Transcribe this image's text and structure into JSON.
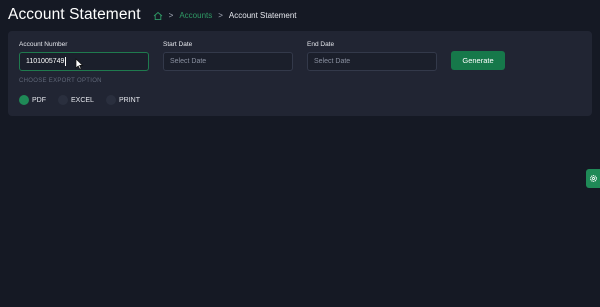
{
  "header": {
    "title": "Account Statement",
    "breadcrumb": {
      "home_icon": "home-icon",
      "link": "Accounts",
      "current": "Account Statement",
      "separator": ">"
    }
  },
  "form": {
    "account_number": {
      "label": "Account Number",
      "value": "1101005749"
    },
    "start_date": {
      "label": "Start Date",
      "placeholder": "Select Date"
    },
    "end_date": {
      "label": "End Date",
      "placeholder": "Select Date"
    },
    "generate_label": "Generate",
    "export_label": "CHOOSE EXPORT OPTION",
    "export_options": [
      {
        "label": "PDF",
        "selected": true
      },
      {
        "label": "EXCEL",
        "selected": false
      },
      {
        "label": "PRINT",
        "selected": false
      }
    ]
  },
  "colors": {
    "background": "#151924",
    "card": "#212533",
    "accent": "#1f8a57",
    "link": "#2f9a65"
  },
  "side_tab": {
    "icon": "gear-icon"
  }
}
